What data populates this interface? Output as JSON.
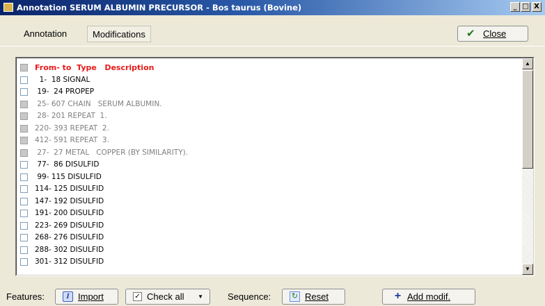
{
  "window": {
    "title": "Annotation SERUM ALBUMIN PRECURSOR - Bos taurus (Bovine)",
    "minimize_glyph": "_",
    "maximize_glyph": "□",
    "close_glyph": "X"
  },
  "tabs": [
    {
      "label": "Annotation",
      "selected": false
    },
    {
      "label": "Modifications",
      "selected": true
    }
  ],
  "close_button": {
    "label": "Close",
    "icon": "check-icon",
    "icon_color": "#1b7a1e"
  },
  "list": {
    "header": "From- to  Type   Description",
    "rows": [
      {
        "text": "  1-  18 SIGNAL",
        "checked": false,
        "dim": false
      },
      {
        "text": " 19-  24 PROPEP",
        "checked": false,
        "dim": false
      },
      {
        "text": " 25- 607 CHAIN   SERUM ALBUMIN.",
        "checked": false,
        "dim": true
      },
      {
        "text": " 28- 201 REPEAT  1.",
        "checked": false,
        "dim": true
      },
      {
        "text": "220- 393 REPEAT  2.",
        "checked": false,
        "dim": true
      },
      {
        "text": "412- 591 REPEAT  3.",
        "checked": false,
        "dim": true
      },
      {
        "text": " 27-  27 METAL   COPPER (BY SIMILARITY).",
        "checked": false,
        "dim": true
      },
      {
        "text": " 77-  86 DISULFID",
        "checked": false,
        "dim": false
      },
      {
        "text": " 99- 115 DISULFID",
        "checked": false,
        "dim": false
      },
      {
        "text": "114- 125 DISULFID",
        "checked": false,
        "dim": false
      },
      {
        "text": "147- 192 DISULFID",
        "checked": false,
        "dim": false
      },
      {
        "text": "191- 200 DISULFID",
        "checked": false,
        "dim": false
      },
      {
        "text": "223- 269 DISULFID",
        "checked": false,
        "dim": false
      },
      {
        "text": "268- 276 DISULFID",
        "checked": false,
        "dim": false
      },
      {
        "text": "288- 302 DISULFID",
        "checked": false,
        "dim": false
      },
      {
        "text": "301- 312 DISULFID",
        "checked": false,
        "dim": false
      }
    ],
    "header_color": "#e81a1a",
    "dim_color": "#7f7f7f"
  },
  "bottombar": {
    "features_label": "Features:",
    "import_label": "Import",
    "check_all_label": "Check all",
    "sequence_label": "Sequence:",
    "reset_label": "Reset",
    "add_modif_label": "Add modif."
  },
  "colors": {
    "titlebar_start": "#0a246a",
    "titlebar_end": "#a6caf0",
    "background": "#ece9d8"
  }
}
